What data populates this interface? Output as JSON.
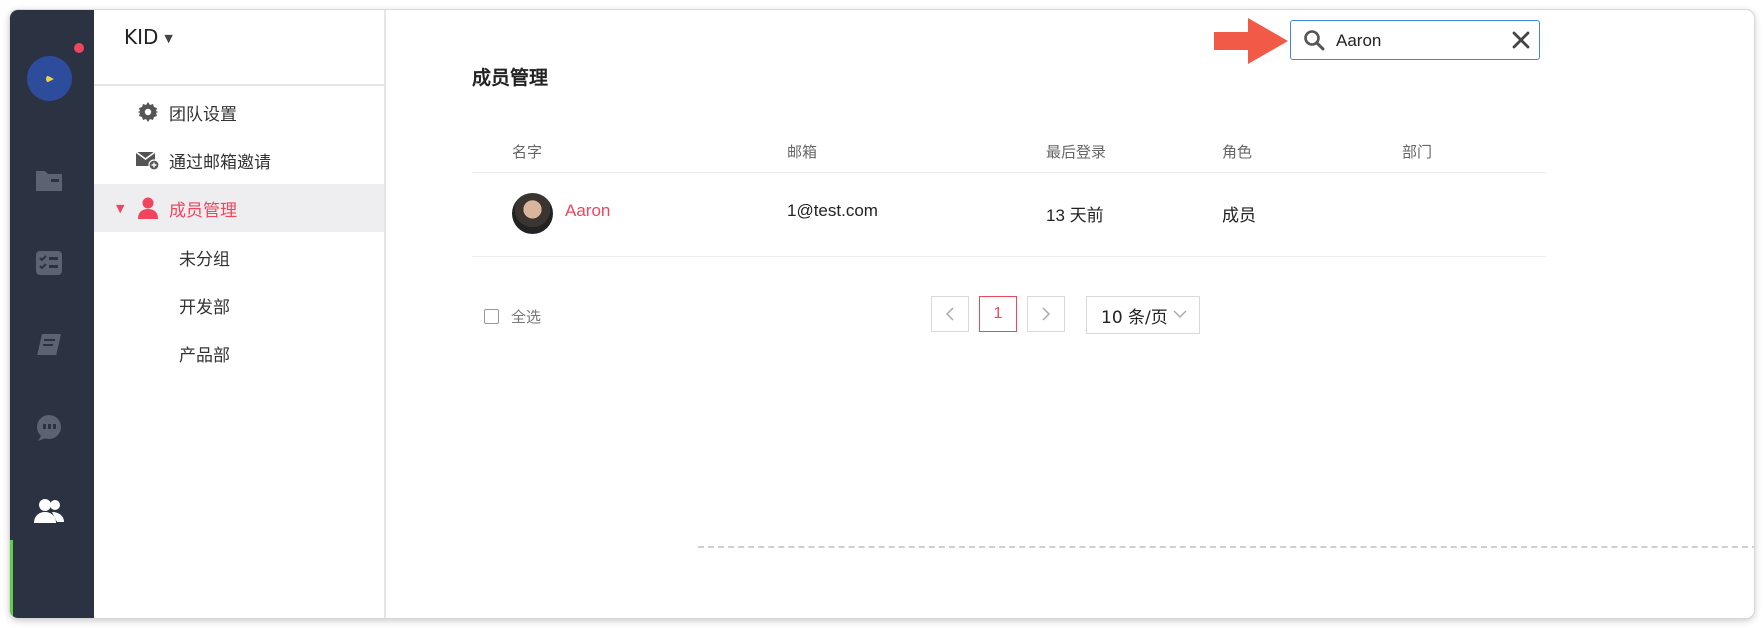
{
  "team": {
    "name": "KID"
  },
  "menu": {
    "items": [
      {
        "label": "团队设置",
        "icon": "gear-icon"
      },
      {
        "label": "通过邮箱邀请",
        "icon": "mail-add-icon"
      },
      {
        "label": "成员管理",
        "icon": "user-icon",
        "active": true
      }
    ],
    "sub_items": [
      {
        "label": "未分组"
      },
      {
        "label": "开发部"
      },
      {
        "label": "产品部"
      }
    ]
  },
  "page": {
    "title": "成员管理"
  },
  "search": {
    "value": "Aaron"
  },
  "table": {
    "columns": [
      "名字",
      "邮箱",
      "最后登录",
      "角色",
      "部门"
    ],
    "rows": [
      {
        "name": "Aaron",
        "email": "1@test.com",
        "last_login": "13 天前",
        "role": "成员",
        "department": ""
      }
    ]
  },
  "footer": {
    "select_all_label": "全选",
    "current_page": "1",
    "page_size_label": "10 条/页"
  },
  "colors": {
    "accent": "#f0455d",
    "rail_bg": "#2b3242",
    "search_border": "#3d8bd9",
    "arrow": "#f05a46",
    "active_indicator": "#5fcf4a"
  }
}
